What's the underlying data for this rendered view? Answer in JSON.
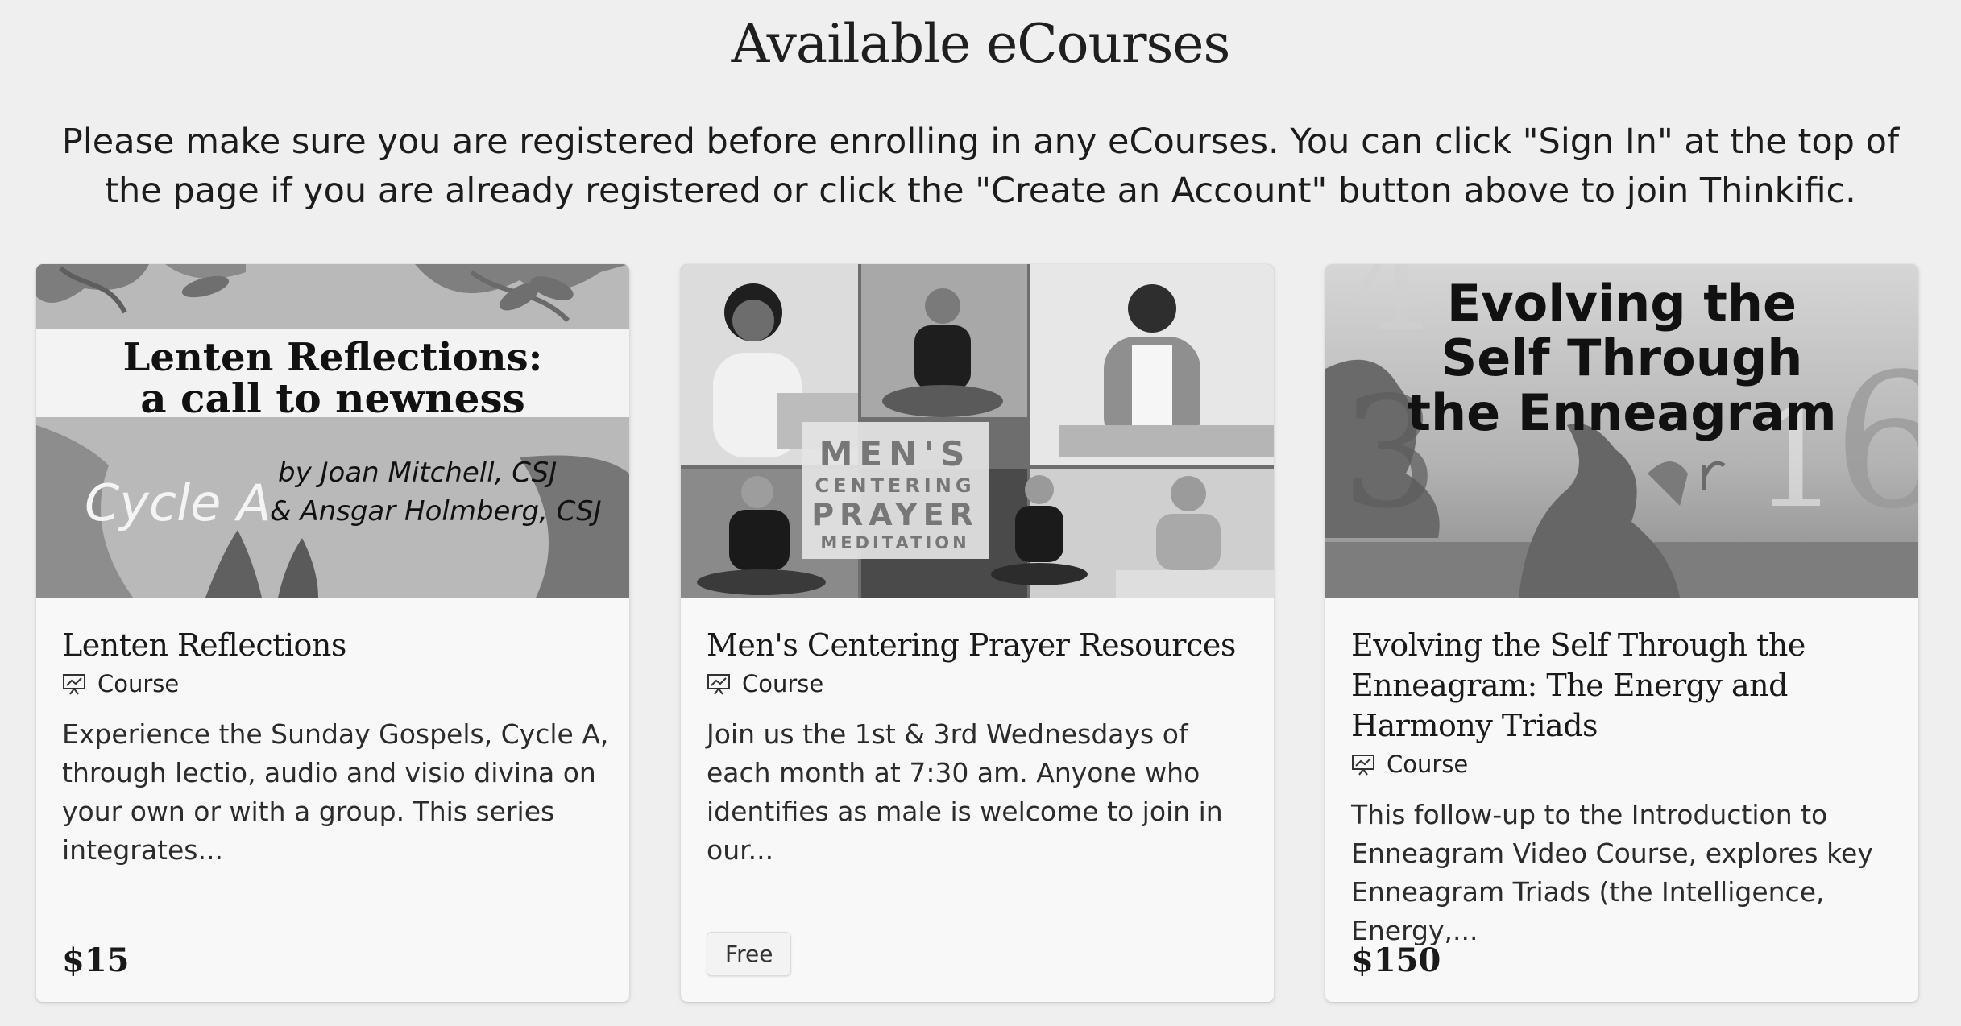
{
  "heading": "Available eCourses",
  "intro": "Please make sure you are registered before enrolling in any eCourses. You can click \"Sign In\" at the top of the page if you are already registered or click the \"Create an Account\" button above to join Thinkific.",
  "courses": [
    {
      "title": "Lenten Reflections",
      "type": "Course",
      "description": "Experience the Sunday Gospels, Cycle A, through lectio, audio and visio divina on your own or with a group. This series integrates...",
      "price": "$15",
      "thumb": {
        "line1": "Lenten Reflections:",
        "line2": "a call to newness",
        "cycle": "Cycle A",
        "byline1": "by Joan Mitchell, CSJ",
        "byline2": "& Ansgar Holmberg, CSJ"
      }
    },
    {
      "title": "Men's Centering Prayer Resources",
      "type": "Course",
      "description": "Join us the 1st & 3rd Wednesdays of each month at 7:30 am. Anyone who identifies as male is welcome to join in our...",
      "price": "Free",
      "thumb": {
        "line1": "MEN'S",
        "line2": "CENTERING",
        "line3": "PRAYER",
        "line4": "MEDITATION"
      }
    },
    {
      "title": "Evolving the Self Through the Enneagram: The Energy and Harmony Triads",
      "type": "Course",
      "description": "This follow-up to the Introduction to Enneagram Video Course, explores key Enneagram Triads (the Intelligence, Energy,...",
      "price": "$150",
      "thumb": {
        "line1": "Evolving the",
        "line2": "Self Through",
        "line3": "the Enneagram"
      }
    }
  ],
  "icons": {
    "course_type": "presentation-chart-icon"
  }
}
